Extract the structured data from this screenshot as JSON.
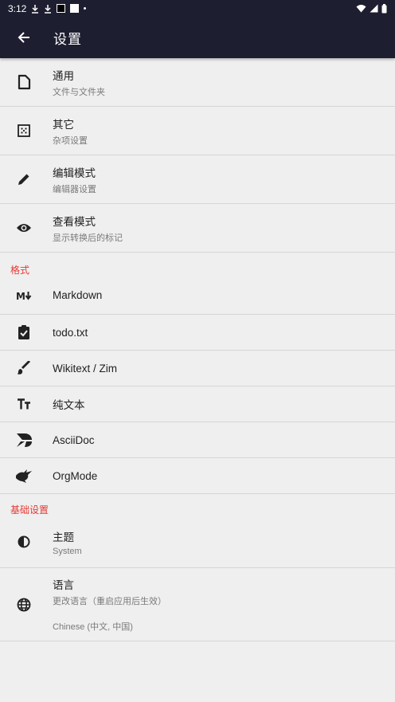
{
  "status_bar": {
    "time": "3:12"
  },
  "app_bar": {
    "title": "设置"
  },
  "top_items": [
    {
      "title": "通用",
      "subtitle": "文件与文件夹"
    },
    {
      "title": "其它",
      "subtitle": "杂项设置"
    },
    {
      "title": "编辑模式",
      "subtitle": "编辑器设置"
    },
    {
      "title": "查看模式",
      "subtitle": "显示转换后的标记"
    }
  ],
  "format_section": {
    "header": "格式",
    "items": [
      "Markdown",
      "todo.txt",
      "Wikitext / Zim",
      "纯文本",
      "AsciiDoc",
      "OrgMode"
    ]
  },
  "basic_section": {
    "header": "基础设置",
    "theme": {
      "title": "主题",
      "subtitle": "System"
    },
    "language": {
      "title": "语言",
      "subtitle": "更改语言（重启应用后生效）",
      "value": "Chinese (中文, 中国)"
    }
  },
  "colors": {
    "appbar": "#1e1e31",
    "section_header": "#e53935",
    "background": "#efefef"
  }
}
